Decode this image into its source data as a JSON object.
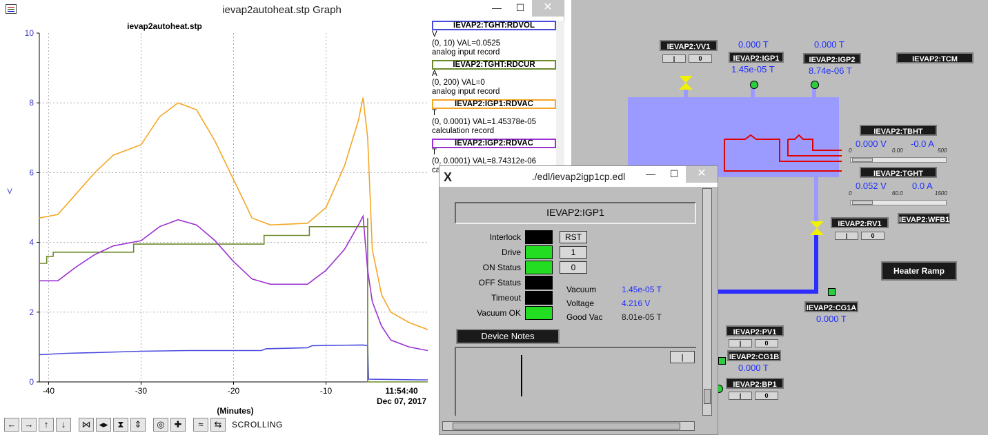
{
  "graph_window": {
    "title": "ievap2autoheat.stp Graph",
    "controls": {
      "minimize": "—",
      "maximize": "☐",
      "close": "✕"
    }
  },
  "chart_data": {
    "type": "line",
    "title": "ievap2autoheat.stp",
    "xlabel": "(Minutes)",
    "ylabel": "V",
    "xlim": [
      -41,
      1
    ],
    "ylim": [
      0,
      10
    ],
    "x_ticks": [
      -40,
      -30,
      -20,
      -10
    ],
    "y_ticks": [
      0,
      2,
      4,
      6,
      8,
      10
    ],
    "time_label": "11:54:40",
    "date_label": "Dec 07, 2017",
    "grid": true,
    "series": [
      {
        "name": "IEVAP2:TGHT:RDVOL",
        "color": "#4a4adf",
        "x": [
          -41,
          -38,
          -35,
          -30,
          -25,
          -20,
          -17,
          -16.5,
          -12,
          -11.5,
          -6,
          -5.5,
          -5.4,
          0,
          1
        ],
        "y": [
          0.78,
          0.82,
          0.84,
          0.88,
          0.9,
          0.9,
          0.9,
          0.95,
          0.98,
          1.04,
          1.06,
          1.04,
          0.08,
          0.06,
          0.06
        ]
      },
      {
        "name": "IEVAP2:TGHT:RDCUR",
        "color": "#6b8a2a",
        "x": [
          -41,
          -40.2,
          -40.2,
          -39.5,
          -39.5,
          -30.8,
          -30.8,
          -16.7,
          -16.7,
          -11.8,
          -11.8,
          -5.5,
          -5.5,
          -5.5,
          1
        ],
        "y": [
          3.4,
          3.4,
          3.6,
          3.6,
          3.72,
          3.72,
          3.95,
          3.95,
          4.2,
          4.2,
          4.45,
          4.45,
          4.7,
          0.0,
          0.0
        ]
      },
      {
        "name": "IEVAP2:IGP1:RDVAC",
        "color": "#f5a623",
        "x": [
          -41,
          -39,
          -37,
          -35,
          -33,
          -30,
          -28,
          -26,
          -24,
          -22,
          -20,
          -18,
          -16,
          -12,
          -10,
          -8,
          -6.5,
          -6,
          -5.5,
          -5,
          -4,
          -3,
          -1,
          1
        ],
        "y": [
          4.7,
          4.8,
          5.4,
          6.0,
          6.5,
          6.8,
          7.6,
          8.0,
          7.8,
          6.9,
          5.8,
          4.7,
          4.5,
          4.55,
          5.0,
          6.2,
          7.5,
          8.15,
          7.0,
          3.8,
          2.5,
          2.0,
          1.7,
          1.5
        ]
      },
      {
        "name": "IEVAP2:IGP2:RDVAC",
        "color": "#9b30d0",
        "x": [
          -41,
          -39,
          -37,
          -35,
          -33,
          -30,
          -28,
          -26,
          -24,
          -22,
          -20,
          -18,
          -16,
          -12,
          -10,
          -8,
          -6.5,
          -6,
          -5.5,
          -5,
          -4,
          -3,
          -1,
          1
        ],
        "y": [
          2.9,
          2.9,
          3.3,
          3.65,
          3.9,
          4.05,
          4.45,
          4.65,
          4.5,
          4.05,
          3.45,
          2.95,
          2.8,
          2.8,
          3.2,
          3.8,
          4.5,
          4.75,
          3.2,
          2.3,
          1.6,
          1.2,
          1.0,
          0.9
        ]
      }
    ]
  },
  "legend": [
    {
      "pv": "IEVAP2:TGHT:RDVOL",
      "color": "#4a4adf",
      "unit": "V",
      "range": "(0, 10) VAL=0.0525",
      "record": "analog input record"
    },
    {
      "pv": "IEVAP2:TGHT:RDCUR",
      "color": "#6b8a2a",
      "unit": "A",
      "range": "(0, 200) VAL=0",
      "record": "analog input record"
    },
    {
      "pv": "IEVAP2:IGP1:RDVAC",
      "color": "#f5a623",
      "unit": "T",
      "range": "(0, 0.0001) VAL=1.45378e-05",
      "record": "calculation record"
    },
    {
      "pv": "IEVAP2:IGP2:RDVAC",
      "color": "#9b30d0",
      "unit": "T",
      "range": "(0, 0.0001) VAL=8.74312e-06",
      "record": "calculation record"
    }
  ],
  "toolbar": {
    "icons": [
      "left-arrow",
      "right-arrow",
      "up-arrow",
      "down-arrow",
      "zoom-x-in",
      "zoom-x-out",
      "zoom-y-in",
      "zoom-y-out",
      "circle",
      "crosshair",
      "autoscale",
      "scroll-toggle"
    ],
    "glyphs": [
      "←",
      "→",
      "↑",
      "↓",
      "⋈",
      "◂▸",
      "⧗",
      "⇕",
      "◎",
      "✚",
      "≈",
      "⇆"
    ],
    "mode_label": "SCROLLING"
  },
  "synoptic": {
    "labels": {
      "vv1": "IEVAP2:VV1",
      "igp1": "IEVAP2:IGP1",
      "igp2": "IEVAP2:IGP2",
      "tcm": "IEVAP2:TCM",
      "tbht": "IEVAP2:TBHT",
      "tght": "IEVAP2:TGHT",
      "rv1": "IEVAP2:RV1",
      "wfb1": "IEVAP2:WFB1",
      "cg1a": "IEVAP2:CG1A",
      "pv1": "IEVAP2:PV1",
      "cg1b": "IEVAP2:CG1B",
      "bp1": "IEVAP2:BP1"
    },
    "values": {
      "igp1_setpt": "0.000 T",
      "igp2_setpt": "0.000 T",
      "igp1": "1.45e-05 T",
      "igp2": "8.74e-06 T",
      "tbht_v": "0.000 V",
      "tbht_a": "-0.0 A",
      "tght_v": "0.052 V",
      "tght_a": "0.0 A",
      "cg1a": "0.000 T",
      "cg1b": "0.000 T"
    },
    "scale_labels": {
      "tbht_min": "0",
      "tbht_mid": "0.00",
      "tbht_max": "500",
      "tght_min": "0",
      "tght_mid": "60.0",
      "tght_max": "1500"
    },
    "button_texts": {
      "open": "|",
      "close": "0"
    },
    "heater_ramp": "Heater Ramp"
  },
  "igp_window": {
    "title": "./edl/ievap2igp1cp.edl",
    "device": "IEVAP2:IGP1",
    "statuses": [
      {
        "label": "Interlock",
        "color": "#000000"
      },
      {
        "label": "Drive",
        "color": "#22dd22"
      },
      {
        "label": "ON Status",
        "color": "#22dd22"
      },
      {
        "label": "OFF Status",
        "color": "#000000"
      },
      {
        "label": "Timeout",
        "color": "#000000"
      },
      {
        "label": "Vacuum OK",
        "color": "#22dd22"
      }
    ],
    "buttons": {
      "reset": "RST",
      "on": "1",
      "off": "0"
    },
    "readings": [
      {
        "label": "Vacuum",
        "value": "1.45e-05 T"
      },
      {
        "label": "Voltage",
        "value": "4.216 V"
      },
      {
        "label": "Good Vac",
        "value": "8.01e-05 T"
      }
    ],
    "notes_button": "Device Notes",
    "notes_toggle": "|"
  }
}
